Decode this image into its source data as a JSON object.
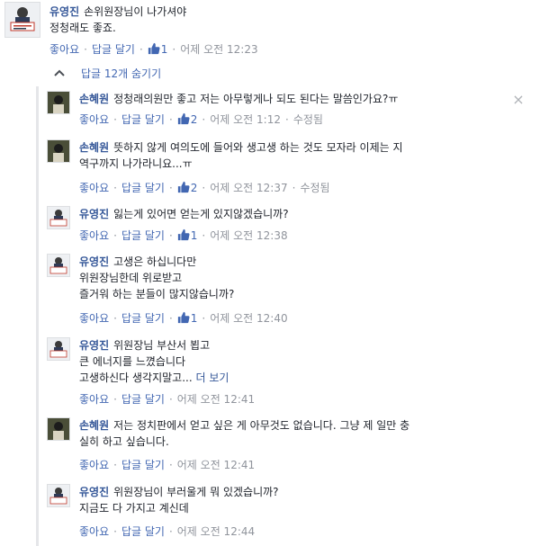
{
  "top_comment": {
    "author": "유영진",
    "lines": [
      "손위원장님이 나가셔야",
      "정청래도 좋죠."
    ],
    "like_label": "좋아요",
    "reply_label": "답글 달기",
    "like_count": "1",
    "time": "어제 오전 12:23"
  },
  "replies_toggle": {
    "label": "답글 12개 숨기기"
  },
  "replies": [
    {
      "author": "손혜원",
      "lines": [
        "정청래의원만 좋고 저는 아무렇게나 되도 된다는 말씀인가요?ㅠ"
      ],
      "like_label": "좋아요",
      "reply_label": "답글 달기",
      "like_count": "2",
      "time": "어제 오전 1:12",
      "edited": "수정됨"
    },
    {
      "author": "손혜원",
      "lines": [
        "뜻하지 않게 여의도에 들어와 생고생 하는 것도 모자라 이제는 지",
        "역구까지 나가라니요...ㅠ"
      ],
      "like_label": "좋아요",
      "reply_label": "답글 달기",
      "like_count": "2",
      "time": "어제 오전 12:37",
      "edited": "수정됨"
    },
    {
      "author": "유영진",
      "lines": [
        "잃는게 있어면 얻는게 있지않겠습니까?"
      ],
      "like_label": "좋아요",
      "reply_label": "답글 달기",
      "like_count": "1",
      "time": "어제 오전 12:38"
    },
    {
      "author": "유영진",
      "lines": [
        "고생은 하십니다만",
        "위원장님한데 위로받고",
        "즐거워 하는 분들이 많지않습니까?"
      ],
      "like_label": "좋아요",
      "reply_label": "답글 달기",
      "like_count": "1",
      "time": "어제 오전 12:40"
    },
    {
      "author": "유영진",
      "lines": [
        "위원장님 부산서 뵙고",
        "큰 에너지를 느꼈습니다",
        "고생하신다 생각지말고..."
      ],
      "more_label": "더 보기",
      "like_label": "좋아요",
      "reply_label": "답글 달기",
      "time": "어제 오전 12:41"
    },
    {
      "author": "손혜원",
      "lines": [
        "저는 정치판에서 얻고 싶은 게 아무것도 없습니다. 그냥 제 일만 충",
        "실히 하고 싶습니다."
      ],
      "like_label": "좋아요",
      "reply_label": "답글 달기",
      "time": "어제 오전 12:41"
    },
    {
      "author": "유영진",
      "lines": [
        "위원장님이 부러울게 뭐 있겠습니까?",
        "지금도 다 가지고 계신데"
      ],
      "like_label": "좋아요",
      "reply_label": "답글 달기",
      "time": "어제 오전 12:44"
    }
  ],
  "icons": {
    "thumb": "thumbs-up-icon",
    "chevron": "chevron-up-icon",
    "close": "close-icon"
  },
  "colors": {
    "link": "#365899",
    "action": "#4267b2",
    "meta": "#90949c"
  }
}
